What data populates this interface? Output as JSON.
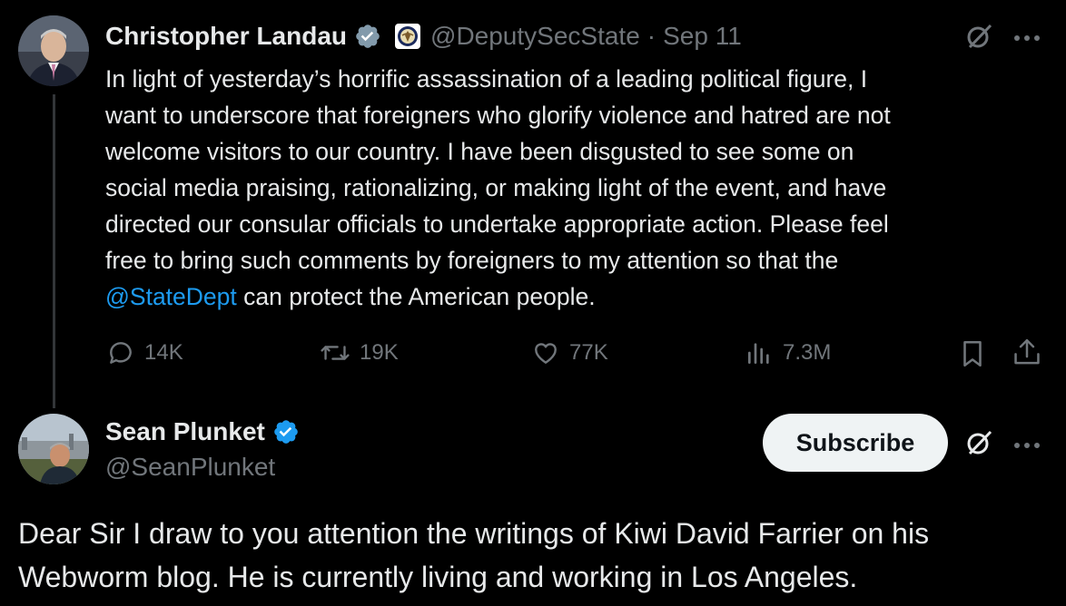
{
  "tweet": {
    "author_name": "Christopher Landau",
    "handle": "@DeputySecState",
    "separator": "·",
    "date": "Sep 11",
    "body_lines": [
      "In light of yesterday’s horrific assassination of a leading political figure, I",
      "want to underscore that foreigners who glorify violence and hatred are not",
      "welcome visitors to our country. I have been disgusted to see some on",
      "social media praising, rationalizing, or making light of the event, and have",
      "directed our consular officials to undertake appropriate action. Please feel",
      "free to bring such comments by foreigners to my attention so that the"
    ],
    "mention": "@StateDept",
    "last_line_rest": " can protect the American people.",
    "metrics": {
      "replies": "14K",
      "reposts": "19K",
      "likes": "77K",
      "views": "7.3M"
    }
  },
  "reply": {
    "author_name": "Sean Plunket",
    "handle": "@SeanPlunket",
    "subscribe_label": "Subscribe",
    "body_lines": [
      "Dear Sir I draw to you attention the writings of Kiwi David Farrier on his",
      "Webworm blog. He is currently living and working in Los Angeles."
    ]
  },
  "colors": {
    "background": "#000000",
    "text": "#e7e9ea",
    "muted": "#71767b",
    "accent": "#1d9bf0",
    "verified_badge_gray": "#829aab",
    "verified_badge_blue": "#1d9bf0"
  },
  "icons": [
    "grok-icon",
    "more-icon",
    "reply-icon",
    "repost-icon",
    "like-icon",
    "views-icon",
    "bookmark-icon",
    "share-icon",
    "verified-badge-icon",
    "affiliate-seal-icon"
  ]
}
